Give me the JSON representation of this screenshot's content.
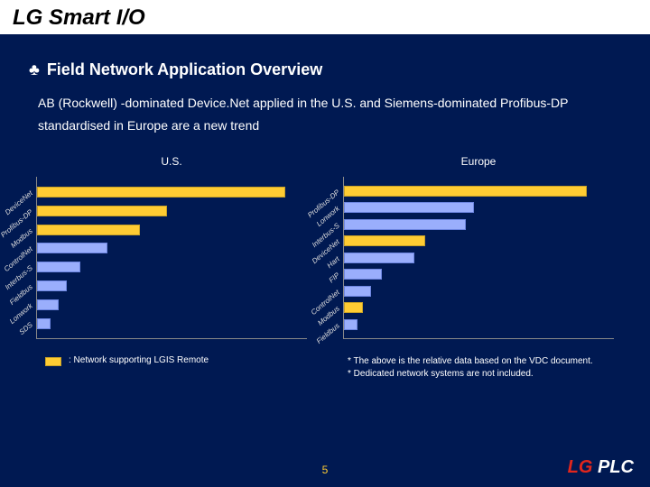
{
  "header": {
    "title": "LG Smart I/O"
  },
  "section": {
    "bullet_glyph": "♣",
    "title": "Field Network Application Overview",
    "description": "AB (Rockwell) -dominated Device.Net applied in the U.S. and Siemens-dominated Profibus-DP standardised in Europe are a new trend"
  },
  "chart_data": [
    {
      "type": "bar",
      "title": "U.S.",
      "orientation": "horizontal",
      "xlabel": "",
      "ylabel": "",
      "xlim": [
        0,
        100
      ],
      "series": [
        {
          "name": "DeviceNet",
          "value": 92,
          "highlight": true
        },
        {
          "name": "Profibus-DP",
          "value": 48,
          "highlight": true
        },
        {
          "name": "Modbus",
          "value": 38,
          "highlight": true
        },
        {
          "name": "ControlNet",
          "value": 26,
          "highlight": false
        },
        {
          "name": "Interbus-S",
          "value": 16,
          "highlight": false
        },
        {
          "name": "Fieldbus",
          "value": 11,
          "highlight": false
        },
        {
          "name": "Lonwork",
          "value": 8,
          "highlight": false
        },
        {
          "name": "SDS",
          "value": 5,
          "highlight": false
        }
      ]
    },
    {
      "type": "bar",
      "title": "Europe",
      "orientation": "horizontal",
      "xlabel": "",
      "ylabel": "",
      "xlim": [
        0,
        100
      ],
      "series": [
        {
          "name": "Profibus-DP",
          "value": 90,
          "highlight": true
        },
        {
          "name": "Lonwork",
          "value": 48,
          "highlight": false
        },
        {
          "name": "Interbus-S",
          "value": 45,
          "highlight": false
        },
        {
          "name": "DeviceNet",
          "value": 30,
          "highlight": true
        },
        {
          "name": "Hart",
          "value": 26,
          "highlight": false
        },
        {
          "name": "FIP",
          "value": 14,
          "highlight": false
        },
        {
          "name": "ControlNet",
          "value": 10,
          "highlight": false
        },
        {
          "name": "Modbus",
          "value": 7,
          "highlight": true
        },
        {
          "name": "Fieldbus",
          "value": 5,
          "highlight": false
        }
      ]
    }
  ],
  "legend": {
    "swatch_label": ": Network supporting LGIS Remote",
    "note1": "* The above is the relative data based on the VDC document.",
    "note2": "* Dedicated network systems are not included."
  },
  "footer": {
    "page": "5",
    "brand_lg": "LG",
    "brand_plc": "PLC"
  },
  "colors": {
    "highlight": "#ffcc33",
    "normal": "#9aaefc",
    "background": "#001952"
  }
}
